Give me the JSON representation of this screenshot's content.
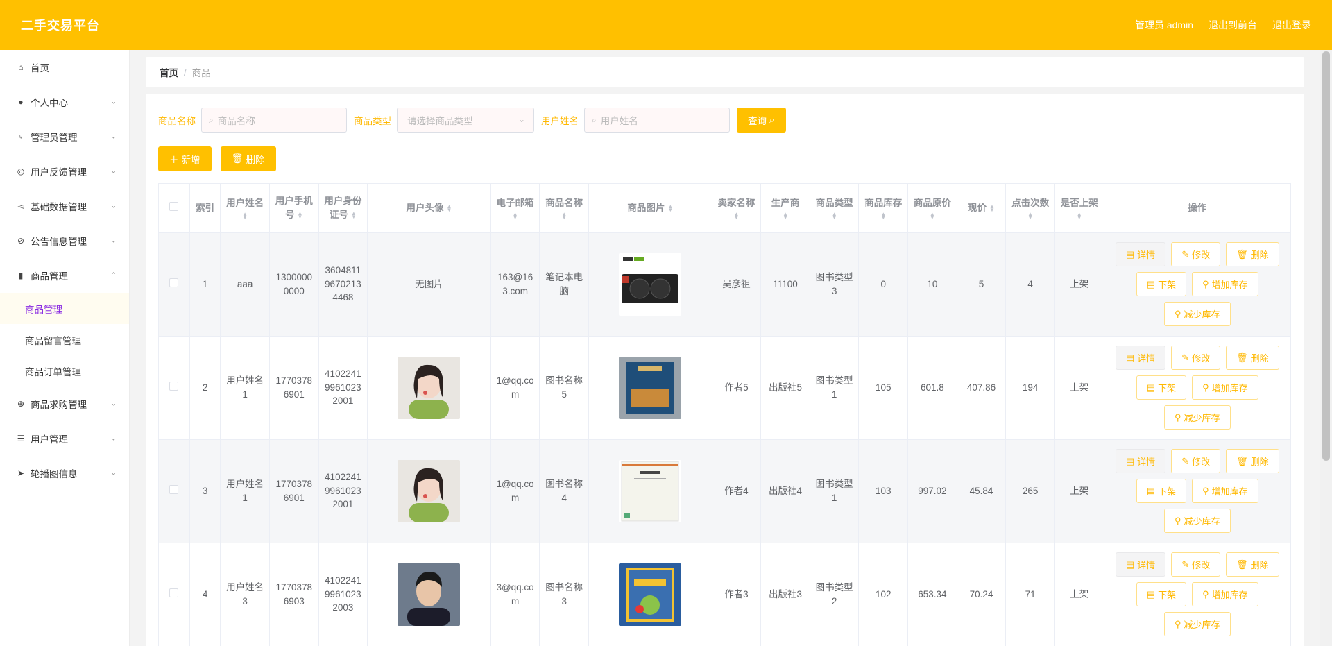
{
  "app": {
    "title": "二手交易平台"
  },
  "topbar": {
    "admin": "管理员 admin",
    "to_front": "退出到前台",
    "logout": "退出登录"
  },
  "sidebar": {
    "items": [
      {
        "label": "首页",
        "icon": "home-icon",
        "has_arrow": false
      },
      {
        "label": "个人中心",
        "icon": "user-icon",
        "has_arrow": true
      },
      {
        "label": "管理员管理",
        "icon": "microphone-icon",
        "has_arrow": true
      },
      {
        "label": "用户反馈管理",
        "icon": "compass-icon",
        "has_arrow": true
      },
      {
        "label": "基础数据管理",
        "icon": "send-icon",
        "has_arrow": true
      },
      {
        "label": "公告信息管理",
        "icon": "bell-off-icon",
        "has_arrow": true
      },
      {
        "label": "商品管理",
        "icon": "bar-chart-icon",
        "has_arrow": true,
        "expanded": true
      },
      {
        "label": "商品求购管理",
        "icon": "globe-icon",
        "has_arrow": true
      },
      {
        "label": "用户管理",
        "icon": "list-icon",
        "has_arrow": true
      },
      {
        "label": "轮播图信息",
        "icon": "paper-plane-icon",
        "has_arrow": true
      }
    ],
    "submenu": [
      {
        "label": "商品管理",
        "active": true
      },
      {
        "label": "商品留言管理",
        "active": false
      },
      {
        "label": "商品订单管理",
        "active": false
      }
    ]
  },
  "breadcrumb": {
    "home": "首页",
    "sep": "/",
    "current": "商品"
  },
  "search": {
    "name_label": "商品名称",
    "name_placeholder": "商品名称",
    "type_label": "商品类型",
    "type_placeholder": "请选择商品类型",
    "user_label": "用户姓名",
    "user_placeholder": "用户姓名",
    "query_button": "查询"
  },
  "actions": {
    "add": "新增",
    "delete": "删除"
  },
  "table": {
    "columns": [
      "索引",
      "用户姓名",
      "用户手机号",
      "用户身份证号",
      "用户头像",
      "电子邮箱",
      "商品名称",
      "商品图片",
      "卖家名称",
      "生产商",
      "商品类型",
      "商品库存",
      "商品原价",
      "现价",
      "点击次数",
      "是否上架",
      "操作"
    ],
    "op_labels": {
      "detail": "详情",
      "edit": "修改",
      "delete": "删除",
      "off_shelf": "下架",
      "add_stock": "增加库存",
      "reduce_stock": "减少库存"
    },
    "rows": [
      {
        "index": "1",
        "user_name": "aaa",
        "phone": "13000000000",
        "id_card": "360481196702134468",
        "avatar": "无图片",
        "email": "163@163.com",
        "product": "笔记本电脑",
        "image": "graphics-card",
        "seller": "吴彦祖",
        "maker": "11100",
        "type": "图书类型3",
        "stock": "0",
        "price": "10",
        "now_price": "5",
        "clicks": "4",
        "on_shelf": "上架"
      },
      {
        "index": "2",
        "user_name": "用户姓名1",
        "phone": "17703786901",
        "id_card": "410224199610232001",
        "avatar": "photo",
        "email": "1@qq.com",
        "product": "图书名称5",
        "image": "book-blue",
        "seller": "作者5",
        "maker": "出版社5",
        "type": "图书类型1",
        "stock": "105",
        "price": "601.8",
        "now_price": "407.86",
        "clicks": "194",
        "on_shelf": "上架"
      },
      {
        "index": "3",
        "user_name": "用户姓名1",
        "phone": "17703786901",
        "id_card": "410224199610232001",
        "avatar": "photo",
        "email": "1@qq.com",
        "product": "图书名称4",
        "image": "book-white",
        "seller": "作者4",
        "maker": "出版社4",
        "type": "图书类型1",
        "stock": "103",
        "price": "997.02",
        "now_price": "45.84",
        "clicks": "265",
        "on_shelf": "上架"
      },
      {
        "index": "4",
        "user_name": "用户姓名3",
        "phone": "17703786903",
        "id_card": "410224199610232003",
        "avatar": "photo-male",
        "email": "3@qq.com",
        "product": "图书名称3",
        "image": "book-romance",
        "seller": "作者3",
        "maker": "出版社3",
        "type": "图书类型2",
        "stock": "102",
        "price": "653.34",
        "now_price": "70.24",
        "clicks": "71",
        "on_shelf": "上架"
      }
    ]
  },
  "colors": {
    "brand": "#ffc000",
    "label": "#ffb800",
    "active_menu": "#8a2be2"
  }
}
